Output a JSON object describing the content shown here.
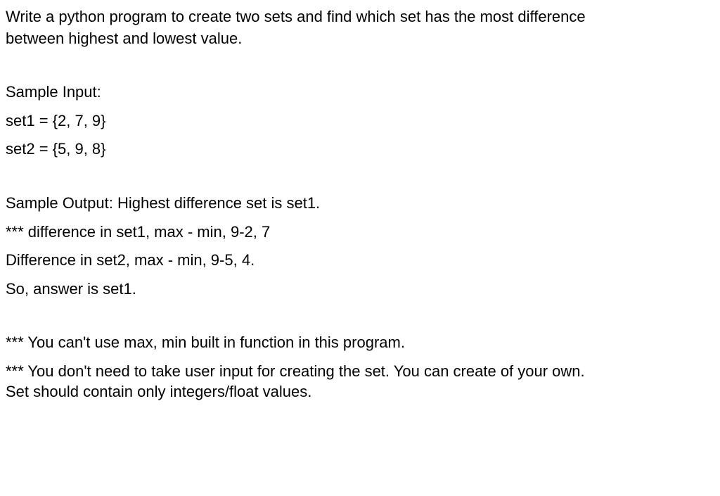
{
  "title_line1": "Write a python program to create two sets and find which set has the most difference",
  "title_line2": "between highest and lowest value.",
  "sample_input_heading": "Sample Input:",
  "set1_line": "set1 = {2, 7, 9}",
  "set2_line": "set2 = {5, 9, 8}",
  "sample_output_line": "Sample Output: Highest difference set is set1.",
  "diff_set1_line": "*** difference in set1, max - min, 9-2, 7",
  "diff_set2_line": "Difference in set2, max - min, 9-5, 4.",
  "so_answer_line": "So, answer is set1.",
  "note1_line": "*** You can't use max, min built in function in this program.",
  "note2_line1": "*** You don't need to take user input for creating the set. You can create of your own.",
  "note2_line2": "Set should contain only integers/float values."
}
